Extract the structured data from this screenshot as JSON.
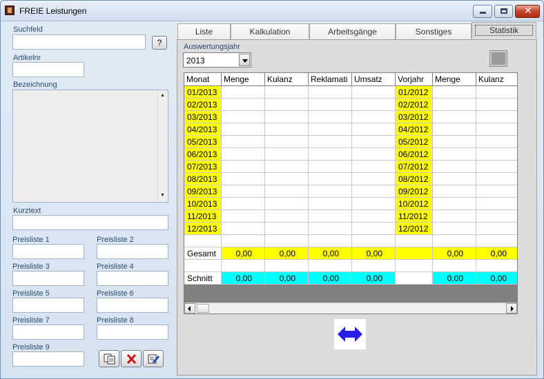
{
  "window": {
    "title": "FREIE Leistungen",
    "icon": "app-icon",
    "min_icon": "minimize-icon",
    "max_icon": "maximize-icon",
    "close_glyph": "✕"
  },
  "left": {
    "suchfeld_label": "Suchfeld",
    "suchfeld_value": "",
    "search_button": "?",
    "artikelnr_label": "Artikelnr",
    "artikelnr_value": "",
    "bezeichnung_label": "Bezeichnung",
    "bezeichnung_value": "",
    "kurztext_label": "Kurztext",
    "kurztext_value": "",
    "preislisten": [
      {
        "label": "Preisliste 1",
        "value": ""
      },
      {
        "label": "Preisliste 2",
        "value": ""
      },
      {
        "label": "Preisliste 3",
        "value": ""
      },
      {
        "label": "Preisliste 4",
        "value": ""
      },
      {
        "label": "Preisliste 5",
        "value": ""
      },
      {
        "label": "Preisliste 6",
        "value": ""
      },
      {
        "label": "Preisliste 7",
        "value": ""
      },
      {
        "label": "Preisliste 8",
        "value": ""
      },
      {
        "label": "Preisliste 9",
        "value": ""
      }
    ],
    "actions": [
      {
        "name": "copy",
        "icon": "copy-icon"
      },
      {
        "name": "delete",
        "icon": "delete-icon"
      },
      {
        "name": "edit",
        "icon": "edit-icon"
      }
    ]
  },
  "tabs": [
    {
      "label": "Liste",
      "active": false
    },
    {
      "label": "Kalkulation",
      "active": false
    },
    {
      "label": "Arbeitsgänge",
      "active": false
    },
    {
      "label": "Sonstiges",
      "active": false
    },
    {
      "label": "Statistik",
      "active": true
    }
  ],
  "statistik": {
    "year_label": "Auswertungsjahr",
    "year_value": "2013",
    "headers": [
      "Monat",
      "Menge",
      "Kulanz",
      "Reklamati",
      "Umsatz",
      "Vorjahr",
      "Menge",
      "Kulanz"
    ],
    "months_current": [
      "01/2013",
      "02/2013",
      "03/2013",
      "04/2013",
      "05/2013",
      "06/2013",
      "07/2013",
      "08/2013",
      "09/2013",
      "10/2013",
      "11/2013",
      "12/2013"
    ],
    "months_previous": [
      "01/2012",
      "02/2012",
      "03/2012",
      "04/2012",
      "05/2012",
      "06/2012",
      "07/2012",
      "08/2012",
      "09/2012",
      "10/2012",
      "11/2012",
      "12/2012"
    ],
    "gesamt_label": "Gesamt",
    "gesamt_values": [
      "0,00",
      "0,00",
      "0,00",
      "0,00",
      "",
      "0,00",
      "0,00"
    ],
    "schnitt_label": "Schnitt",
    "schnitt_values": [
      "0,00",
      "0,00",
      "0,00",
      "0,00",
      "",
      "0,00",
      "0,00"
    ],
    "colors": {
      "month_highlight": "#ffff00",
      "gesamt": "#ffff00",
      "schnitt": "#00ffff",
      "swap_arrow": "#2a1ee6"
    },
    "swap_icon": "swap-arrows-icon"
  }
}
